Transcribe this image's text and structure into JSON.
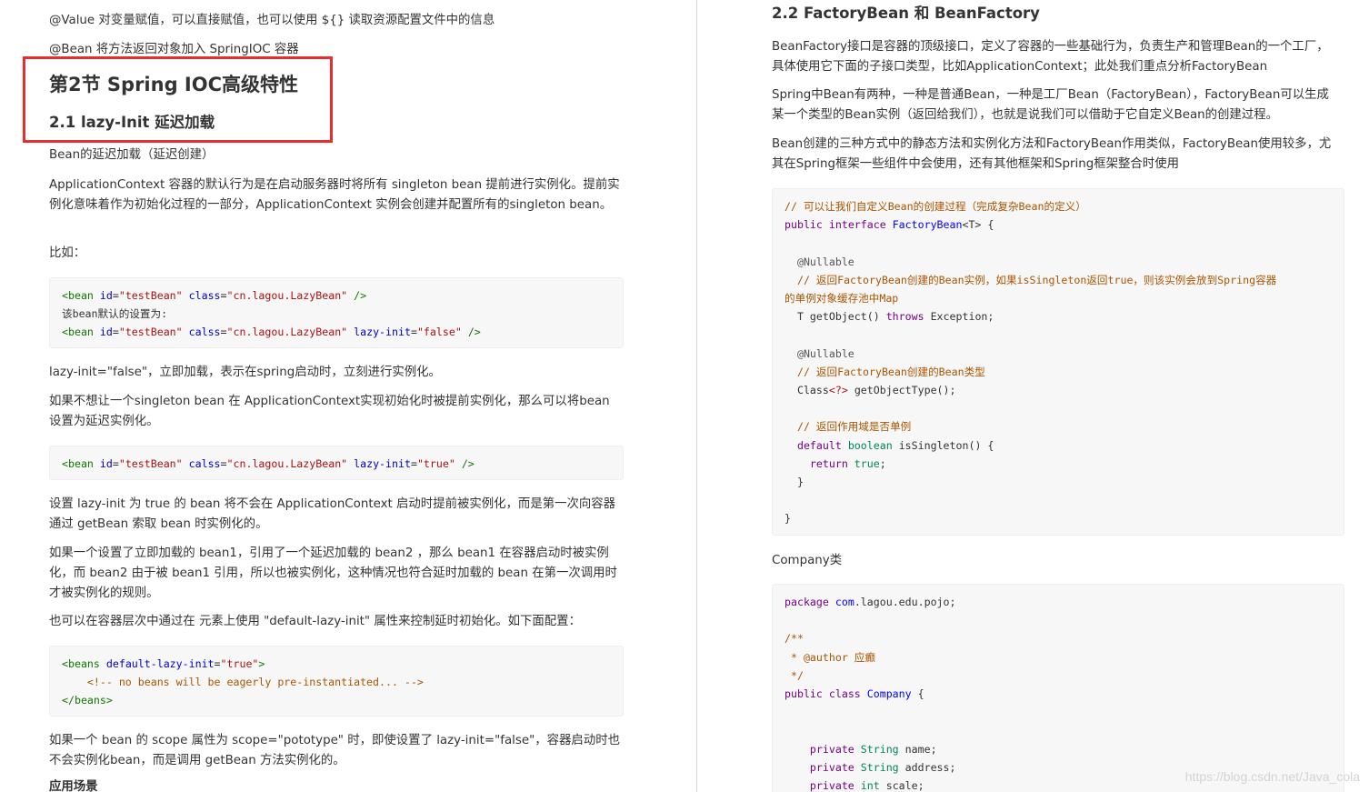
{
  "left": {
    "intro_lines": [
      "@Value 对变量赋值，可以直接赋值，也可以使用 ${} 读取资源配置文件中的信息",
      "@Bean 将方法返回对象加入 SpringIOC 容器"
    ],
    "section_title": "第2节 Spring IOC高级特性",
    "subsection_title": "2.1 lazy-Init 延迟加载",
    "p_lazy_title": "Bean的延迟加载（延迟创建）",
    "p_default_behavior": "ApplicationContext 容器的默认行为是在启动服务器时将所有 singleton bean 提前进行实例化。提前实例化意味着作为初始化过程的一部分，ApplicationContext 实例会创建并配置所有的singleton bean。",
    "p_example": "比如：",
    "code1": {
      "line1": {
        "tag_open": "<bean",
        "attr1": "id",
        "val1": "\"testBean\"",
        "attr2": "class",
        "val2": "\"cn.lagou.LazyBean\"",
        "tag_close": "/>"
      },
      "line2": "该bean默认的设置为:",
      "line3": {
        "tag_open": "<bean",
        "attr1": "id",
        "val1": "\"testBean\"",
        "attr2": "calss",
        "val2": "\"cn.lagou.LazyBean\"",
        "attr3": "lazy-init",
        "val3": "\"false\"",
        "tag_close": "/>"
      }
    },
    "p_lazy_false": "lazy-init=\"false\"，立即加载，表示在spring启动时，立刻进行实例化。",
    "p_no_preinit": "如果不想让一个singleton bean 在 ApplicationContext实现初始化时被提前实例化，那么可以将bean设置为延迟实例化。",
    "code2": {
      "tag_open": "<bean",
      "attr1": "id",
      "val1": "\"testBean\"",
      "attr2": "calss",
      "val2": "\"cn.lagou.LazyBean\"",
      "attr3": "lazy-init",
      "val3": "\"true\"",
      "tag_close": "/>"
    },
    "p_lazy_true": "设置 lazy-init 为 true 的 bean 将不会在 ApplicationContext 启动时提前被实例化，而是第一次向容器通过 getBean 索取 bean 时实例化的。",
    "p_bean1_bean2": "如果一个设置了立即加载的 bean1，引用了一个延迟加载的 bean2 ，那么 bean1 在容器启动时被实例化，而 bean2 由于被 bean1 引用，所以也被实例化，这种情况也符合延时加载的 bean 在第一次调用时才被实例化的规则。",
    "p_default_lazy": "也可以在容器层次中通过在 元素上使用 \"default-lazy-init\" 属性来控制延时初始化。如下面配置：",
    "code3": {
      "open_tag": "<beans",
      "attr": "default-lazy-init",
      "val": "\"true\"",
      "open_end": ">",
      "comment": "<!-- no beans will be eagerly pre-instantiated... -->",
      "close_tag": "</beans>"
    },
    "p_scope": "如果一个 bean 的 scope 属性为 scope=\"pototype\" 时，即使设置了 lazy-init=\"false\"，容器启动时也不会实例化bean，而是调用 getBean 方法实例化的。",
    "p_cut_heading": "应用场景"
  },
  "right": {
    "subsection_title": "2.2 FactoryBean 和 BeanFactory",
    "p1": "BeanFactory接口是容器的顶级接口，定义了容器的一些基础行为，负责生产和管理Bean的一个工厂，具体使用它下面的子接口类型，比如ApplicationContext；此处我们重点分析FactoryBean",
    "p2": "Spring中Bean有两种，一种是普通Bean，一种是工厂Bean（FactoryBean），FactoryBean可以生成某一个类型的Bean实例（返回给我们），也就是说我们可以借助于它自定义Bean的创建过程。",
    "p3": "Bean创建的三种方式中的静态方法和实例化方法和FactoryBean作用类似，FactoryBean使用较多，尤其在Spring框架一些组件中会使用，还有其他框架和Spring框架整合时使用",
    "code_factory": {
      "comment1": "// 可以让我们自定义Bean的创建过程（完成复杂Bean的定义）",
      "kw_public": "public",
      "kw_interface": "interface",
      "iface_name": "FactoryBean",
      "generic": "<T>",
      "brace_open": "{",
      "annot1": "@Nullable",
      "comment2a": "// 返回FactoryBean创建的Bean实例，如果isSingleton返回true，则该实例会放到Spring容器",
      "comment2b": "的单例对象缓存池中Map",
      "method1_pre": "T getObject()",
      "kw_throws": "throws",
      "method1_post": "Exception;",
      "annot2": "@Nullable",
      "comment3": "// 返回FactoryBean创建的Bean类型",
      "method2_type": "Class",
      "method2_generic": "<?>",
      "method2_post": "getObjectType();",
      "comment4": "// 返回作用域是否单例",
      "kw_default": "default",
      "kw_boolean": "boolean",
      "method3": "isSingleton() {",
      "kw_return": "return",
      "kw_true": "true",
      "semicolon": ";",
      "brace_inner_close": "}",
      "brace_close": "}"
    },
    "company_label": "Company类",
    "code_company": {
      "kw_package": "package",
      "pkg_name": "com",
      "pkg_rest": ".lagou.edu.pojo;",
      "doc_open": "/**",
      "doc_author": " * @author 应癫",
      "doc_close": " */",
      "kw_public": "public",
      "kw_class": "class",
      "class_name": "Company",
      "brace_open": "{",
      "kw_private1": "private",
      "type1": "String",
      "field1": "name;",
      "kw_private2": "private",
      "type2": "String",
      "field2": "address;",
      "kw_private3": "private",
      "type3": "int",
      "field3": "scale;"
    }
  },
  "watermark": "https://blog.csdn.net/Java_cola"
}
